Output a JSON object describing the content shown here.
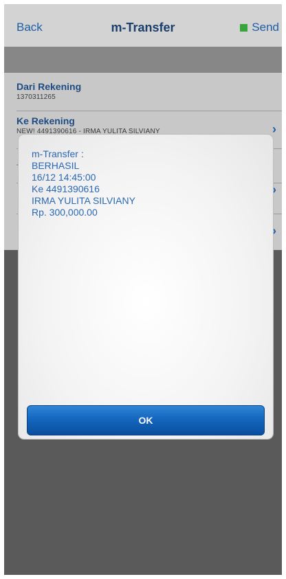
{
  "nav": {
    "back_label": "Back",
    "title": "m-Transfer",
    "send_label": "Send"
  },
  "form": {
    "from_label": "Dari Rekening",
    "from_value": "1370311265",
    "to_label": "Ke Rekening",
    "to_value": "NEW! 4491390616 - IRMA YULITA SILVIANY",
    "amount_dash": "-"
  },
  "dialog": {
    "lines": [
      "m-Transfer :",
      "BERHASIL",
      "16/12 14:45:00",
      "Ke 4491390616",
      "IRMA YULITA SILVIANY",
      "Rp. 300,000.00"
    ],
    "ok_label": "OK"
  },
  "colors": {
    "accent": "#1d5fa8",
    "send_indicator": "#36a63a",
    "button": "#1466be"
  }
}
